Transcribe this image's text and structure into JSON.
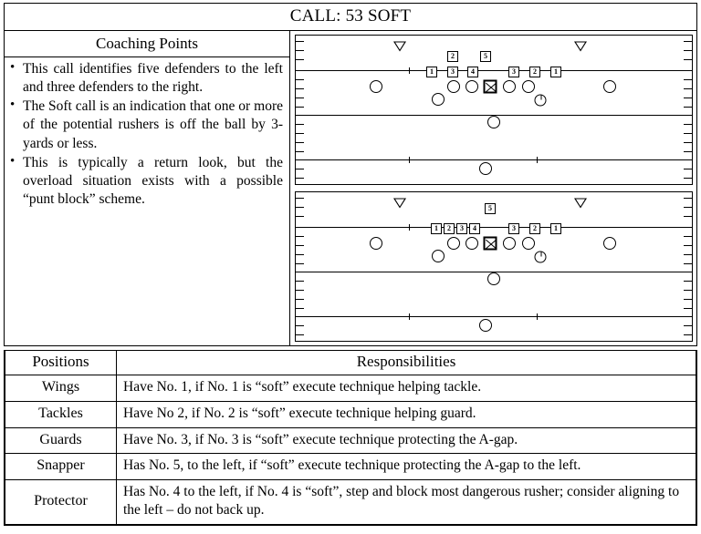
{
  "title": "CALL: 53 SOFT",
  "coaching": {
    "heading": "Coaching Points",
    "points": [
      "This call identifies five defenders to the left and three defenders to the right.",
      "The Soft call is an indication that one or more of the potential rushers is off the ball by 3-yards or less.",
      "This is typically a return look, but the overload situation exists with a possible “punt block” scheme."
    ]
  },
  "diagrams": [
    {
      "name": "top-formation",
      "numbers_upper": [
        "2",
        "5"
      ],
      "numbers_left": [
        "1",
        "3",
        "4"
      ],
      "numbers_right": [
        "3",
        "2",
        "1"
      ],
      "gunners": 2,
      "linemen_circles": 4,
      "snapper_marker": "X-box",
      "wing_circles": 2,
      "protector_marker": "circle-with-stem",
      "deep_circles": 2,
      "outside_circles": 2
    },
    {
      "name": "bottom-formation",
      "numbers_upper": [
        "5"
      ],
      "numbers_left": [
        "1",
        "2",
        "3",
        "4"
      ],
      "numbers_right": [
        "3",
        "2",
        "1"
      ],
      "gunners": 2,
      "linemen_circles": 4,
      "snapper_marker": "X-box",
      "wing_circles": 2,
      "protector_marker": "circle-with-stem",
      "deep_circles": 2,
      "outside_circles": 2
    }
  ],
  "table": {
    "headers": [
      "Positions",
      "Responsibilities"
    ],
    "rows": [
      {
        "position": "Wings",
        "responsibility": "Have No. 1, if No. 1 is “soft” execute technique helping tackle."
      },
      {
        "position": "Tackles",
        "responsibility": "Have No 2, if No. 2 is “soft” execute technique helping guard."
      },
      {
        "position": "Guards",
        "responsibility": "Have No. 3, if No. 3 is “soft” execute technique protecting the A-gap."
      },
      {
        "position": "Snapper",
        "responsibility": "Has No. 5, to the left, if “soft” execute technique protecting the A-gap to the left."
      },
      {
        "position": "Protector",
        "responsibility": "Has No. 4 to the left, if No. 4 is “soft”, step and block most dangerous rusher; consider aligning to the left – do not back up."
      }
    ]
  }
}
